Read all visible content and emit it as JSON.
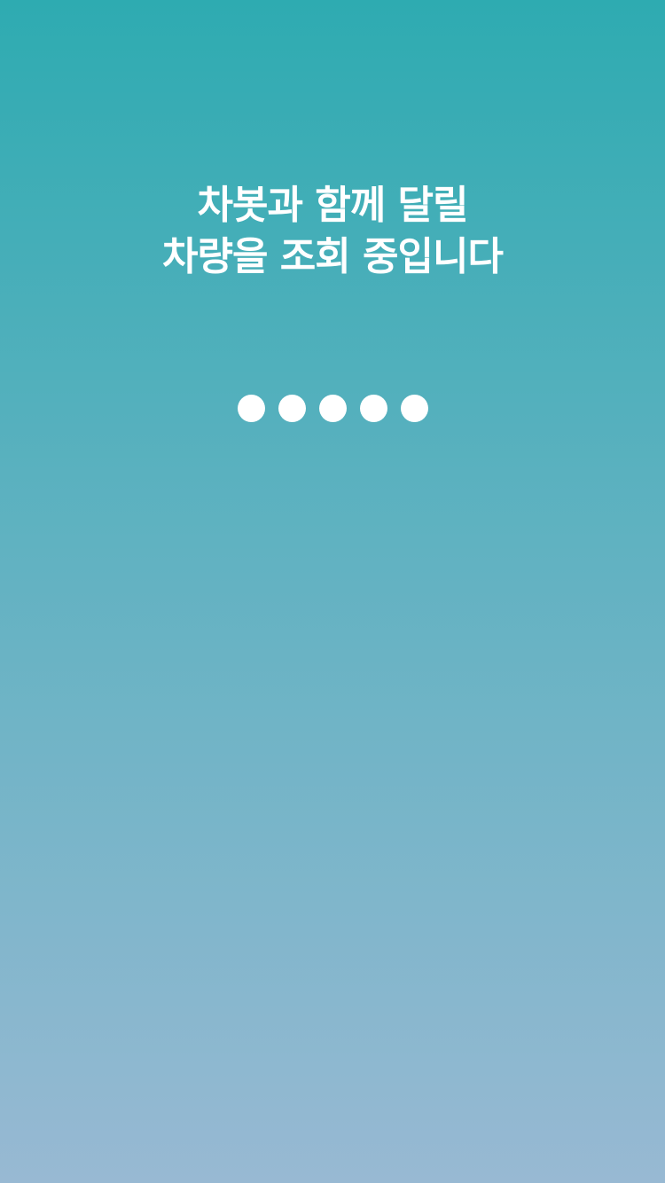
{
  "loading": {
    "message_line1": "차봇과 함께 달릴",
    "message_line2": "차량을 조회 중입니다",
    "indicator_dot_count": 5
  },
  "colors": {
    "background_top": "#2eabb1",
    "background_bottom": "#98b9d3",
    "text": "#ffffff",
    "dots": "#ffffff"
  }
}
